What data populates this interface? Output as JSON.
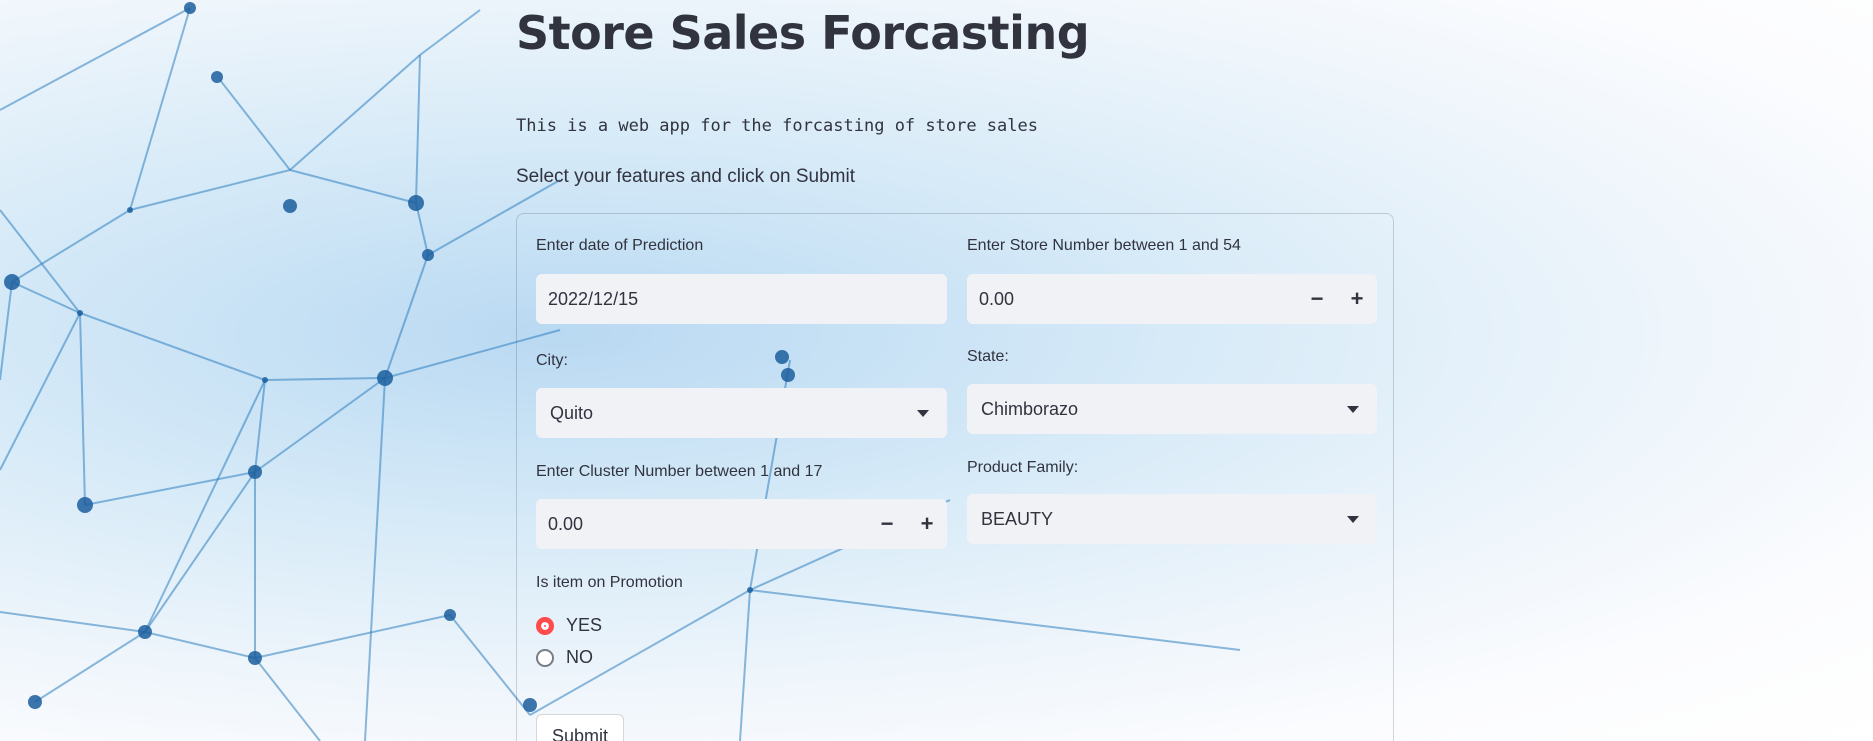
{
  "page": {
    "title": "Store Sales Forcasting",
    "subtitle_code": "This is a web app for the forcasting of store sales",
    "instructions": "Select your features and click on Submit"
  },
  "form": {
    "date": {
      "label": "Enter date of Prediction",
      "value": "2022/12/15"
    },
    "store_number": {
      "label": "Enter Store Number between 1 and 54",
      "value": "0.00",
      "minus": "−",
      "plus": "+"
    },
    "city": {
      "label": "City:",
      "value": "Quito"
    },
    "state": {
      "label": "State:",
      "value": "Chimborazo"
    },
    "cluster_number": {
      "label": "Enter Cluster Number between 1 and 17",
      "value": "0.00",
      "minus": "−",
      "plus": "+"
    },
    "product_family": {
      "label": "Product Family:",
      "value": "BEAUTY"
    },
    "promotion": {
      "label": "Is item on Promotion",
      "options": [
        "YES",
        "NO"
      ],
      "selected": "YES"
    },
    "submit_label": "Submit"
  },
  "colors": {
    "accent": "#ff4b4b",
    "text": "#31333f",
    "input_bg": "#f0f2f6"
  }
}
